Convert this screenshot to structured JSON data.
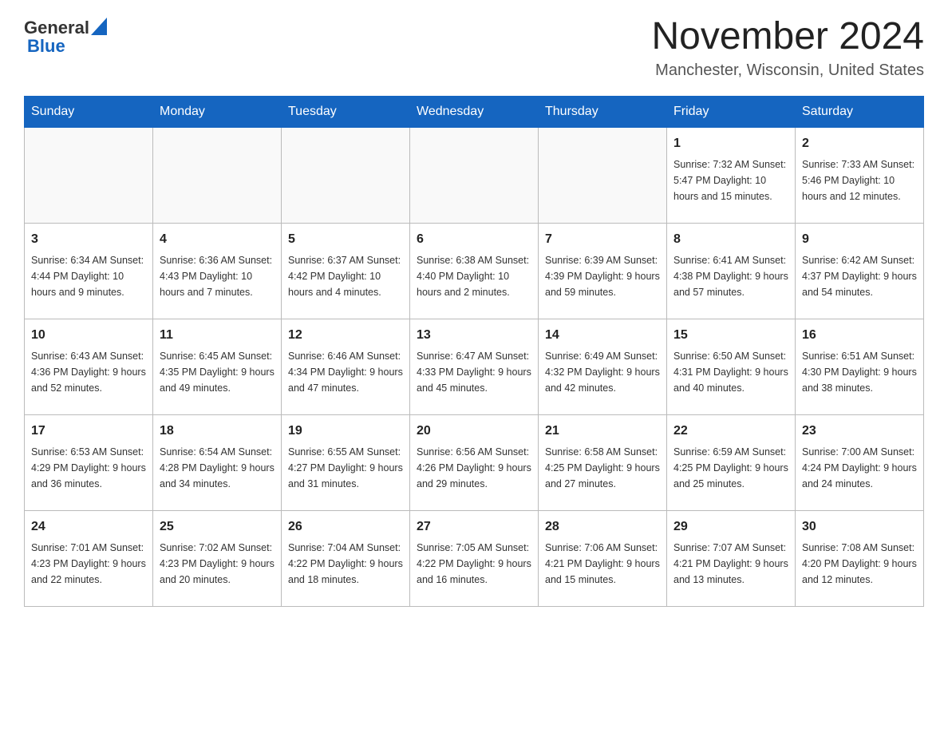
{
  "header": {
    "logo": {
      "general": "General",
      "blue": "Blue"
    },
    "month_year": "November 2024",
    "location": "Manchester, Wisconsin, United States"
  },
  "days_of_week": [
    "Sunday",
    "Monday",
    "Tuesday",
    "Wednesday",
    "Thursday",
    "Friday",
    "Saturday"
  ],
  "weeks": [
    {
      "days": [
        {
          "number": "",
          "info": ""
        },
        {
          "number": "",
          "info": ""
        },
        {
          "number": "",
          "info": ""
        },
        {
          "number": "",
          "info": ""
        },
        {
          "number": "",
          "info": ""
        },
        {
          "number": "1",
          "info": "Sunrise: 7:32 AM\nSunset: 5:47 PM\nDaylight: 10 hours and 15 minutes."
        },
        {
          "number": "2",
          "info": "Sunrise: 7:33 AM\nSunset: 5:46 PM\nDaylight: 10 hours and 12 minutes."
        }
      ]
    },
    {
      "days": [
        {
          "number": "3",
          "info": "Sunrise: 6:34 AM\nSunset: 4:44 PM\nDaylight: 10 hours and 9 minutes."
        },
        {
          "number": "4",
          "info": "Sunrise: 6:36 AM\nSunset: 4:43 PM\nDaylight: 10 hours and 7 minutes."
        },
        {
          "number": "5",
          "info": "Sunrise: 6:37 AM\nSunset: 4:42 PM\nDaylight: 10 hours and 4 minutes."
        },
        {
          "number": "6",
          "info": "Sunrise: 6:38 AM\nSunset: 4:40 PM\nDaylight: 10 hours and 2 minutes."
        },
        {
          "number": "7",
          "info": "Sunrise: 6:39 AM\nSunset: 4:39 PM\nDaylight: 9 hours and 59 minutes."
        },
        {
          "number": "8",
          "info": "Sunrise: 6:41 AM\nSunset: 4:38 PM\nDaylight: 9 hours and 57 minutes."
        },
        {
          "number": "9",
          "info": "Sunrise: 6:42 AM\nSunset: 4:37 PM\nDaylight: 9 hours and 54 minutes."
        }
      ]
    },
    {
      "days": [
        {
          "number": "10",
          "info": "Sunrise: 6:43 AM\nSunset: 4:36 PM\nDaylight: 9 hours and 52 minutes."
        },
        {
          "number": "11",
          "info": "Sunrise: 6:45 AM\nSunset: 4:35 PM\nDaylight: 9 hours and 49 minutes."
        },
        {
          "number": "12",
          "info": "Sunrise: 6:46 AM\nSunset: 4:34 PM\nDaylight: 9 hours and 47 minutes."
        },
        {
          "number": "13",
          "info": "Sunrise: 6:47 AM\nSunset: 4:33 PM\nDaylight: 9 hours and 45 minutes."
        },
        {
          "number": "14",
          "info": "Sunrise: 6:49 AM\nSunset: 4:32 PM\nDaylight: 9 hours and 42 minutes."
        },
        {
          "number": "15",
          "info": "Sunrise: 6:50 AM\nSunset: 4:31 PM\nDaylight: 9 hours and 40 minutes."
        },
        {
          "number": "16",
          "info": "Sunrise: 6:51 AM\nSunset: 4:30 PM\nDaylight: 9 hours and 38 minutes."
        }
      ]
    },
    {
      "days": [
        {
          "number": "17",
          "info": "Sunrise: 6:53 AM\nSunset: 4:29 PM\nDaylight: 9 hours and 36 minutes."
        },
        {
          "number": "18",
          "info": "Sunrise: 6:54 AM\nSunset: 4:28 PM\nDaylight: 9 hours and 34 minutes."
        },
        {
          "number": "19",
          "info": "Sunrise: 6:55 AM\nSunset: 4:27 PM\nDaylight: 9 hours and 31 minutes."
        },
        {
          "number": "20",
          "info": "Sunrise: 6:56 AM\nSunset: 4:26 PM\nDaylight: 9 hours and 29 minutes."
        },
        {
          "number": "21",
          "info": "Sunrise: 6:58 AM\nSunset: 4:25 PM\nDaylight: 9 hours and 27 minutes."
        },
        {
          "number": "22",
          "info": "Sunrise: 6:59 AM\nSunset: 4:25 PM\nDaylight: 9 hours and 25 minutes."
        },
        {
          "number": "23",
          "info": "Sunrise: 7:00 AM\nSunset: 4:24 PM\nDaylight: 9 hours and 24 minutes."
        }
      ]
    },
    {
      "days": [
        {
          "number": "24",
          "info": "Sunrise: 7:01 AM\nSunset: 4:23 PM\nDaylight: 9 hours and 22 minutes."
        },
        {
          "number": "25",
          "info": "Sunrise: 7:02 AM\nSunset: 4:23 PM\nDaylight: 9 hours and 20 minutes."
        },
        {
          "number": "26",
          "info": "Sunrise: 7:04 AM\nSunset: 4:22 PM\nDaylight: 9 hours and 18 minutes."
        },
        {
          "number": "27",
          "info": "Sunrise: 7:05 AM\nSunset: 4:22 PM\nDaylight: 9 hours and 16 minutes."
        },
        {
          "number": "28",
          "info": "Sunrise: 7:06 AM\nSunset: 4:21 PM\nDaylight: 9 hours and 15 minutes."
        },
        {
          "number": "29",
          "info": "Sunrise: 7:07 AM\nSunset: 4:21 PM\nDaylight: 9 hours and 13 minutes."
        },
        {
          "number": "30",
          "info": "Sunrise: 7:08 AM\nSunset: 4:20 PM\nDaylight: 9 hours and 12 minutes."
        }
      ]
    }
  ]
}
